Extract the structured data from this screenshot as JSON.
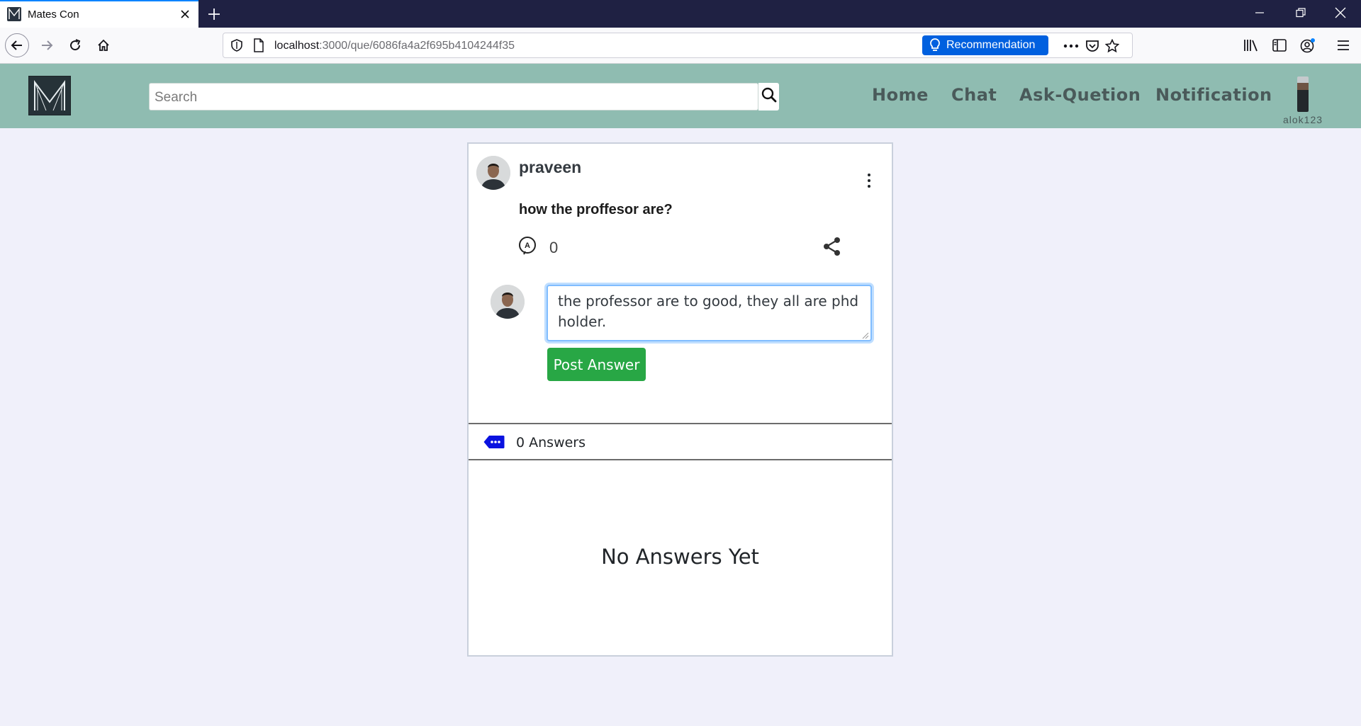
{
  "browser": {
    "tab_title": "Mates Con",
    "url_host": "localhost",
    "url_path": ":3000/que/6086fa4a2f695b4104244f35",
    "recommendation_label": "Recommendation"
  },
  "header": {
    "search_placeholder": "Search",
    "nav": {
      "home": "Home",
      "chat": "Chat",
      "ask": "Ask-Quetion",
      "notification": "Notification"
    },
    "username": "alok123"
  },
  "question": {
    "author": "praveen",
    "text": "how the proffesor are?",
    "answer_count": "0",
    "draft_answer": "the professor are to good, they all are phd holder.",
    "post_button": "Post Answer",
    "answers_label": "0 Answers",
    "empty_message": "No Answers Yet"
  },
  "colors": {
    "header_bg": "#8fbcb1",
    "post_button": "#28a745",
    "recommendation": "#0060df",
    "answers_tag": "#0a12e0"
  }
}
